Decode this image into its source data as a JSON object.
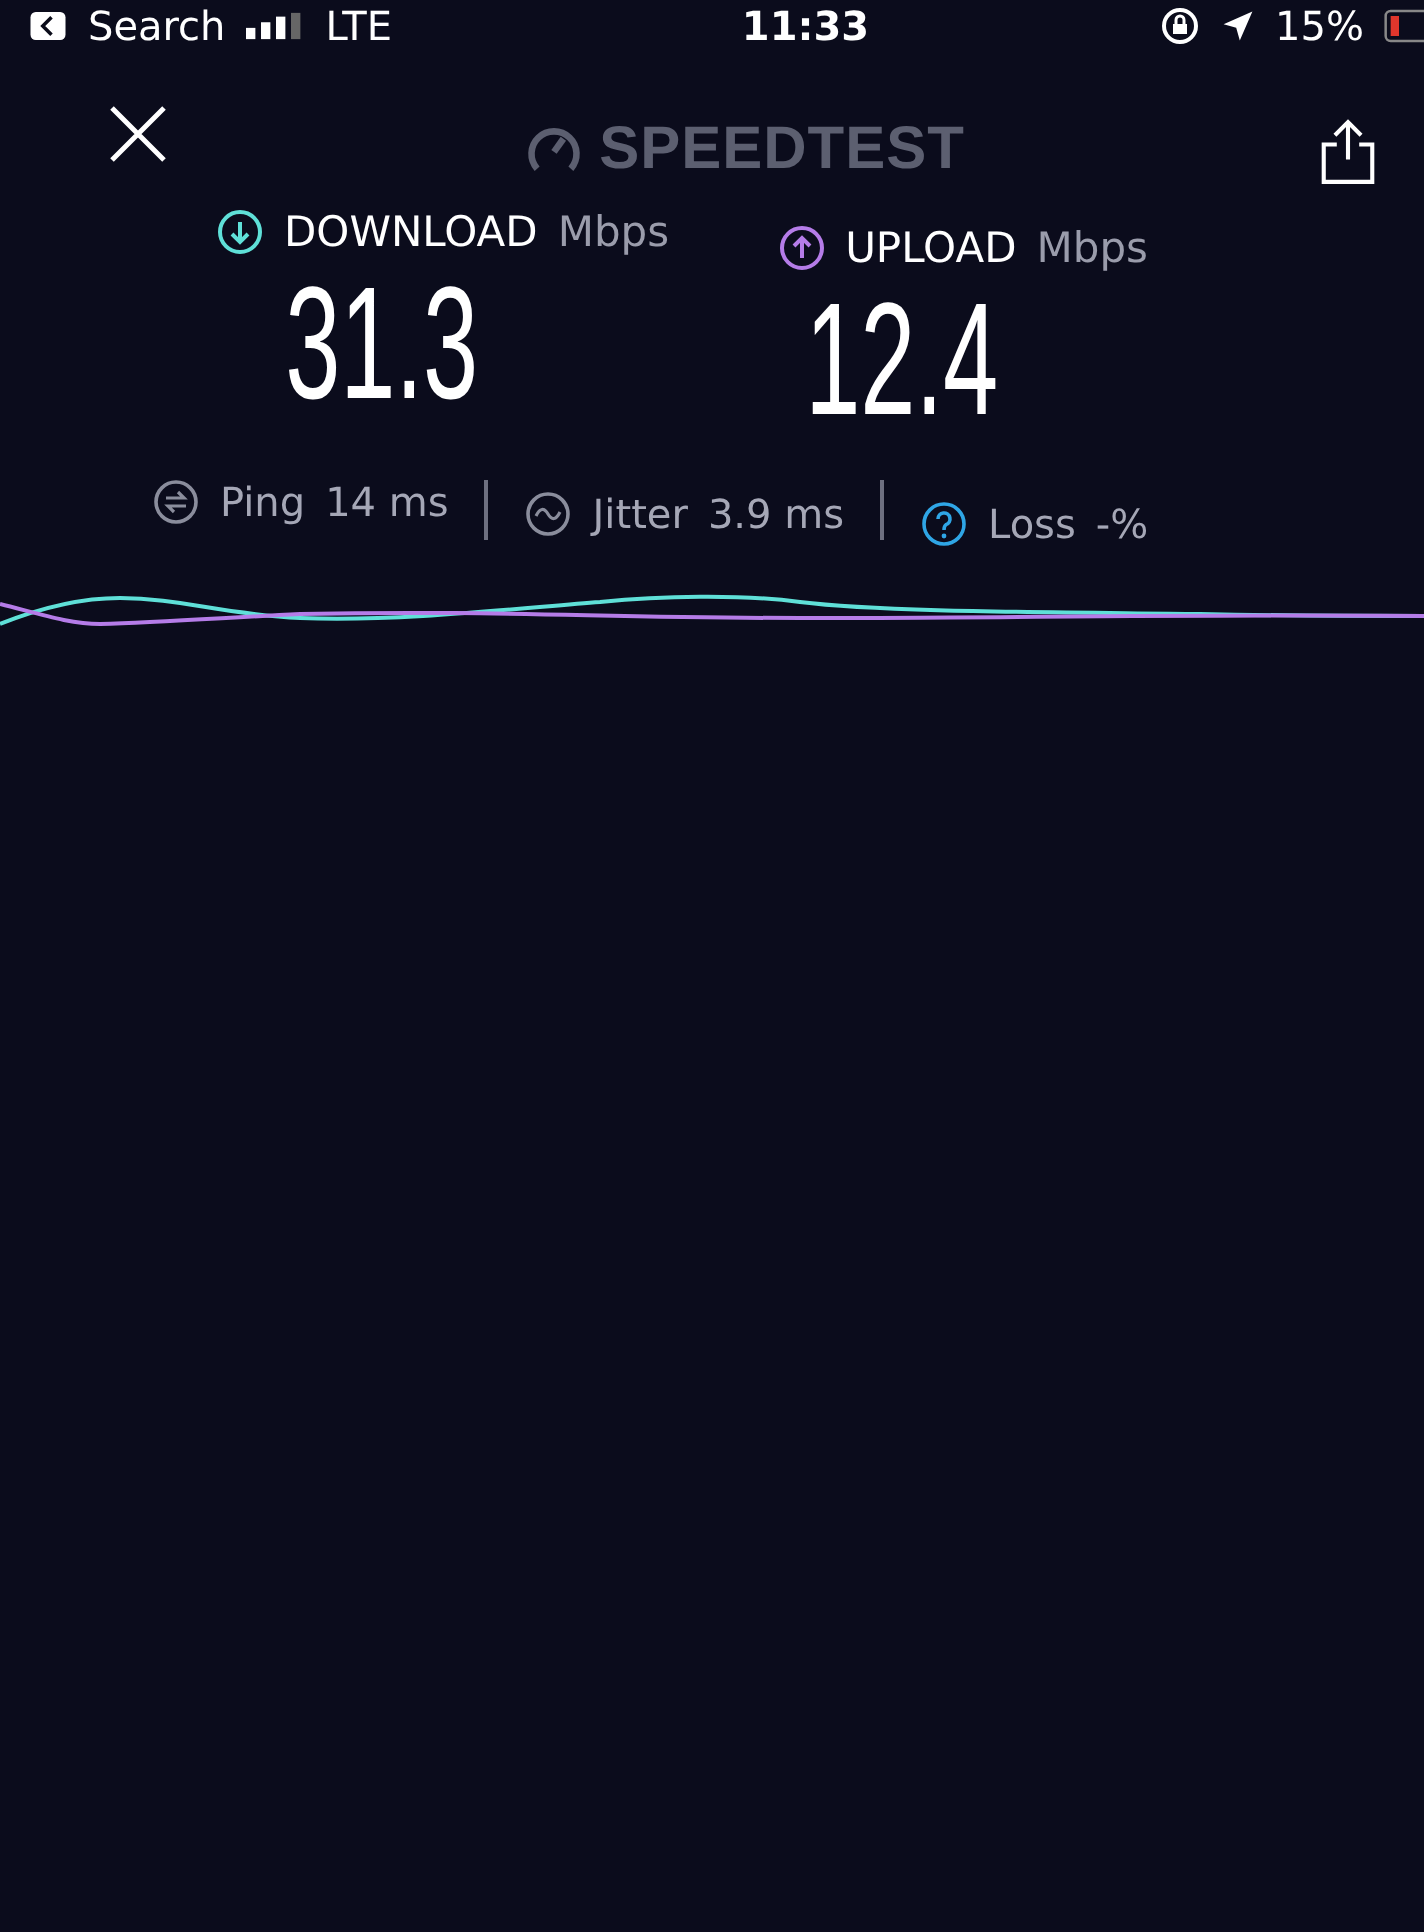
{
  "status_bar": {
    "back_label": "Search",
    "carrier": "LTE",
    "time": "11:33",
    "battery": "15%"
  },
  "header": {
    "logo": "SPEEDTEST"
  },
  "metrics": [
    {
      "kind": "download",
      "label": "DOWNLOAD",
      "unit": "Mbps",
      "value": "31.3",
      "color": "#5fe0d8"
    },
    {
      "kind": "upload",
      "label": "UPLOAD",
      "unit": "Mbps",
      "value": "12.4",
      "color": "#b57ce8"
    }
  ],
  "stats": [
    {
      "kind": "ping",
      "label": "Ping",
      "value": "14 ms"
    },
    {
      "kind": "jitter",
      "label": "Jitter",
      "value": "3.9 ms"
    },
    {
      "kind": "loss",
      "label": "Loss",
      "value": "-%"
    }
  ]
}
